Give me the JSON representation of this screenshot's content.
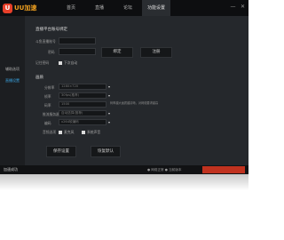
{
  "app": {
    "logo_badge": "U",
    "logo_text": "UU加速"
  },
  "nav": {
    "tabs": [
      "首页",
      "直播",
      "论坛",
      "功能设置"
    ],
    "active_index": 3
  },
  "window_controls": [
    "—",
    "✕"
  ],
  "sidebar": {
    "items": [
      {
        "label": "辅助选项",
        "active": false
      },
      {
        "label": "直播设置",
        "active": true
      }
    ]
  },
  "account": {
    "title": "直播平台账号绑定",
    "account_label": "斗鱼直播账号",
    "account_placeholder": "",
    "password_label": "密码",
    "password_placeholder": "",
    "login_button": "绑定",
    "register_button": "注册",
    "remember_label": "记住密码",
    "remember_option": "下次自动"
  },
  "settings": {
    "title": "画质",
    "rows": [
      {
        "label": "分辨率",
        "value": "1280×720",
        "hint": ""
      },
      {
        "label": "帧率",
        "value": "30fps(推荐)",
        "hint": ""
      },
      {
        "label": "码率",
        "value": "1500",
        "hint": "码率越大画质越清晰，对网络要求越高"
      },
      {
        "label": "推流服务器",
        "value": "自动选择(推荐)",
        "hint": ""
      },
      {
        "label": "编码",
        "value": "x264软编码",
        "hint": ""
      }
    ],
    "audio_label": "音频选项",
    "mic_option": "麦克风",
    "speaker_option": "系统声音"
  },
  "actions": {
    "save": "保存设置",
    "reset": "恢复默认"
  },
  "bottom": {
    "left_text": "加速成功",
    "status_text": "● 网络正常  ● 当前版本"
  }
}
